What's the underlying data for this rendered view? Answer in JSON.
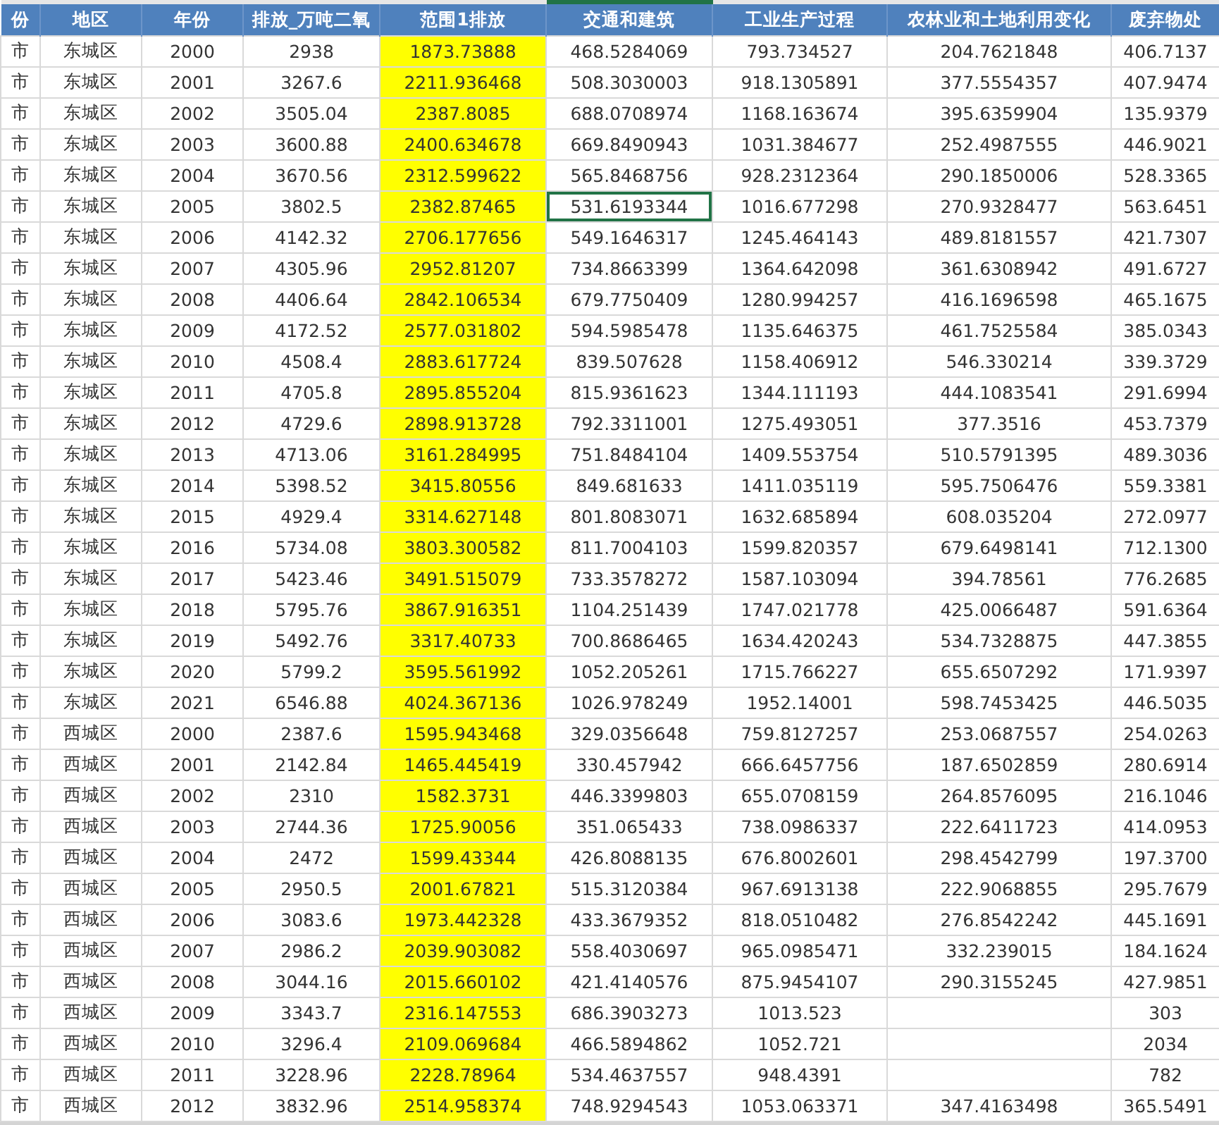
{
  "columns": [
    {
      "header": "份",
      "highlighted": false,
      "selected": false
    },
    {
      "header": "地区",
      "highlighted": false,
      "selected": false
    },
    {
      "header": "年份",
      "highlighted": false,
      "selected": false
    },
    {
      "header": "排放_万吨二氧",
      "highlighted": false,
      "selected": false
    },
    {
      "header": "范围1排放",
      "highlighted": true,
      "selected": false
    },
    {
      "header": "交通和建筑",
      "highlighted": false,
      "selected": true
    },
    {
      "header": "工业生产过程",
      "highlighted": false,
      "selected": false
    },
    {
      "header": "农林业和土地利用变化",
      "highlighted": false,
      "selected": false
    },
    {
      "header": "废弃物处",
      "highlighted": false,
      "selected": false
    }
  ],
  "rows": [
    {
      "selected": false,
      "cells": [
        "市",
        "东城区",
        "2000",
        "2938",
        "1873.73888",
        "468.5284069",
        "793.734527",
        "204.7621848",
        "406.7137"
      ]
    },
    {
      "selected": false,
      "cells": [
        "市",
        "东城区",
        "2001",
        "3267.6",
        "2211.936468",
        "508.3030003",
        "918.1305891",
        "377.5554357",
        "407.9474"
      ]
    },
    {
      "selected": false,
      "cells": [
        "市",
        "东城区",
        "2002",
        "3505.04",
        "2387.8085",
        "688.0708974",
        "1168.163674",
        "395.6359904",
        "135.9379"
      ]
    },
    {
      "selected": false,
      "cells": [
        "市",
        "东城区",
        "2003",
        "3600.88",
        "2400.634678",
        "669.8490943",
        "1031.384677",
        "252.4987555",
        "446.9021"
      ]
    },
    {
      "selected": false,
      "cells": [
        "市",
        "东城区",
        "2004",
        "3670.56",
        "2312.599622",
        "565.8468756",
        "928.2312364",
        "290.1850006",
        "528.3365"
      ]
    },
    {
      "selected": true,
      "cells": [
        "市",
        "东城区",
        "2005",
        "3802.5",
        "2382.87465",
        "531.6193344",
        "1016.677298",
        "270.9328477",
        "563.6451"
      ]
    },
    {
      "selected": false,
      "cells": [
        "市",
        "东城区",
        "2006",
        "4142.32",
        "2706.177656",
        "549.1646317",
        "1245.464143",
        "489.8181557",
        "421.7307"
      ]
    },
    {
      "selected": false,
      "cells": [
        "市",
        "东城区",
        "2007",
        "4305.96",
        "2952.81207",
        "734.8663399",
        "1364.642098",
        "361.6308942",
        "491.6727"
      ]
    },
    {
      "selected": false,
      "cells": [
        "市",
        "东城区",
        "2008",
        "4406.64",
        "2842.106534",
        "679.7750409",
        "1280.994257",
        "416.1696598",
        "465.1675"
      ]
    },
    {
      "selected": false,
      "cells": [
        "市",
        "东城区",
        "2009",
        "4172.52",
        "2577.031802",
        "594.5985478",
        "1135.646375",
        "461.7525584",
        "385.0343"
      ]
    },
    {
      "selected": false,
      "cells": [
        "市",
        "东城区",
        "2010",
        "4508.4",
        "2883.617724",
        "839.507628",
        "1158.406912",
        "546.330214",
        "339.3729"
      ]
    },
    {
      "selected": false,
      "cells": [
        "市",
        "东城区",
        "2011",
        "4705.8",
        "2895.855204",
        "815.9361623",
        "1344.111193",
        "444.1083541",
        "291.6994"
      ]
    },
    {
      "selected": false,
      "cells": [
        "市",
        "东城区",
        "2012",
        "4729.6",
        "2898.913728",
        "792.3311001",
        "1275.493051",
        "377.3516",
        "453.7379"
      ]
    },
    {
      "selected": false,
      "cells": [
        "市",
        "东城区",
        "2013",
        "4713.06",
        "3161.284995",
        "751.8484104",
        "1409.553754",
        "510.5791395",
        "489.3036"
      ]
    },
    {
      "selected": false,
      "cells": [
        "市",
        "东城区",
        "2014",
        "5398.52",
        "3415.80556",
        "849.681633",
        "1411.035119",
        "595.7506476",
        "559.3381"
      ]
    },
    {
      "selected": false,
      "cells": [
        "市",
        "东城区",
        "2015",
        "4929.4",
        "3314.627148",
        "801.8083071",
        "1632.685894",
        "608.035204",
        "272.0977"
      ]
    },
    {
      "selected": false,
      "cells": [
        "市",
        "东城区",
        "2016",
        "5734.08",
        "3803.300582",
        "811.7004103",
        "1599.820357",
        "679.6498141",
        "712.1300"
      ]
    },
    {
      "selected": false,
      "cells": [
        "市",
        "东城区",
        "2017",
        "5423.46",
        "3491.515079",
        "733.3578272",
        "1587.103094",
        "394.78561",
        "776.2685"
      ]
    },
    {
      "selected": false,
      "cells": [
        "市",
        "东城区",
        "2018",
        "5795.76",
        "3867.916351",
        "1104.251439",
        "1747.021778",
        "425.0066487",
        "591.6364"
      ]
    },
    {
      "selected": false,
      "cells": [
        "市",
        "东城区",
        "2019",
        "5492.76",
        "3317.40733",
        "700.8686465",
        "1634.420243",
        "534.7328875",
        "447.3855"
      ]
    },
    {
      "selected": false,
      "cells": [
        "市",
        "东城区",
        "2020",
        "5799.2",
        "3595.561992",
        "1052.205261",
        "1715.766227",
        "655.6507292",
        "171.9397"
      ]
    },
    {
      "selected": false,
      "cells": [
        "市",
        "东城区",
        "2021",
        "6546.88",
        "4024.367136",
        "1026.978249",
        "1952.14001",
        "598.7453425",
        "446.5035"
      ]
    },
    {
      "selected": false,
      "cells": [
        "市",
        "西城区",
        "2000",
        "2387.6",
        "1595.943468",
        "329.0356648",
        "759.8127257",
        "253.0687557",
        "254.0263"
      ]
    },
    {
      "selected": false,
      "cells": [
        "市",
        "西城区",
        "2001",
        "2142.84",
        "1465.445419",
        "330.457942",
        "666.6457756",
        "187.6502859",
        "280.6914"
      ]
    },
    {
      "selected": false,
      "cells": [
        "市",
        "西城区",
        "2002",
        "2310",
        "1582.3731",
        "446.3399803",
        "655.0708159",
        "264.8576095",
        "216.1046"
      ]
    },
    {
      "selected": false,
      "cells": [
        "市",
        "西城区",
        "2003",
        "2744.36",
        "1725.90056",
        "351.065433",
        "738.0986337",
        "222.6411723",
        "414.0953"
      ]
    },
    {
      "selected": false,
      "cells": [
        "市",
        "西城区",
        "2004",
        "2472",
        "1599.43344",
        "426.8088135",
        "676.8002601",
        "298.4542799",
        "197.3700"
      ]
    },
    {
      "selected": false,
      "cells": [
        "市",
        "西城区",
        "2005",
        "2950.5",
        "2001.67821",
        "515.3120384",
        "967.6913138",
        "222.9068855",
        "295.7679"
      ]
    },
    {
      "selected": false,
      "cells": [
        "市",
        "西城区",
        "2006",
        "3083.6",
        "1973.442328",
        "433.3679352",
        "818.0510482",
        "276.8542242",
        "445.1691"
      ]
    },
    {
      "selected": false,
      "cells": [
        "市",
        "西城区",
        "2007",
        "2986.2",
        "2039.903082",
        "558.4030697",
        "965.0985471",
        "332.239015",
        "184.1624"
      ]
    },
    {
      "selected": false,
      "cells": [
        "市",
        "西城区",
        "2008",
        "3044.16",
        "2015.660102",
        "421.4140576",
        "875.9454107",
        "290.3155245",
        "427.9851"
      ]
    },
    {
      "selected": false,
      "cells": [
        "市",
        "西城区",
        "2009",
        "3343.7",
        "2316.147553",
        "686.3903273",
        "1013.523",
        null,
        "303"
      ]
    },
    {
      "selected": false,
      "cells": [
        "市",
        "西城区",
        "2010",
        "3296.4",
        "2109.069684",
        "466.5894862",
        "1052.721",
        null,
        "2034"
      ]
    },
    {
      "selected": false,
      "cells": [
        "市",
        "西城区",
        "2011",
        "3228.96",
        "2228.78964",
        "534.4637557",
        "948.4391",
        null,
        "782"
      ]
    },
    {
      "selected": false,
      "cells": [
        "市",
        "西城区",
        "2012",
        "3832.96",
        "2514.958374",
        "748.9294543",
        "1053.063371",
        "347.4163498",
        "365.5491"
      ]
    }
  ]
}
